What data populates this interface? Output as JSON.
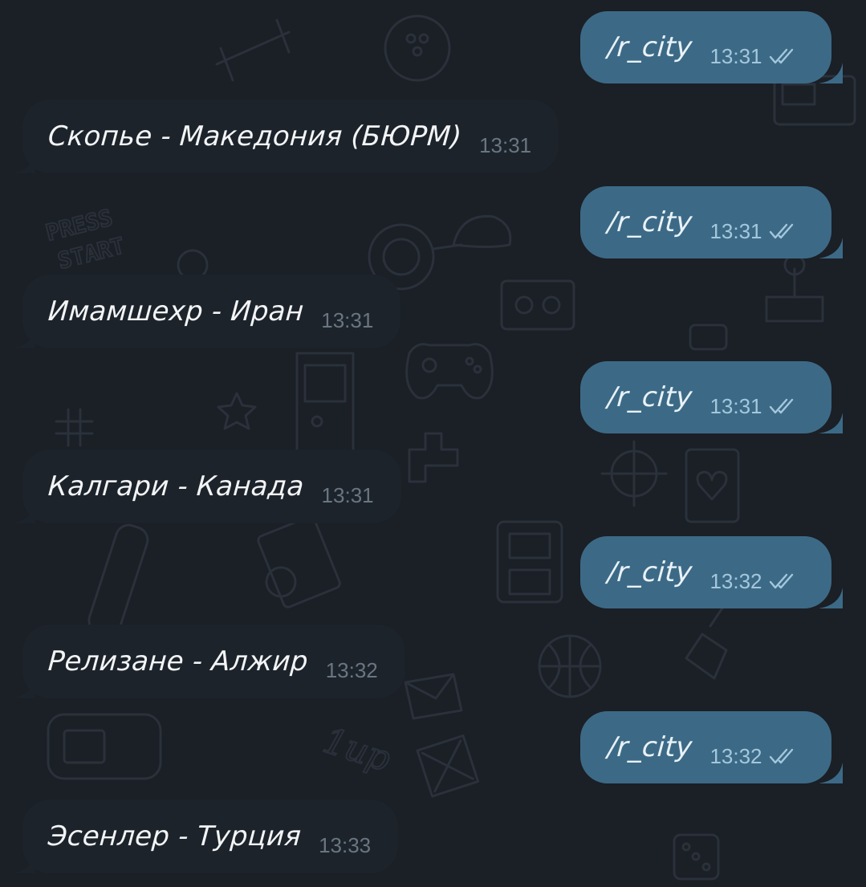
{
  "colors": {
    "background": "#1b1f26",
    "incoming_bubble": "#1c232b",
    "outgoing_bubble": "#3c6a86",
    "incoming_time": "#6a7580",
    "outgoing_time": "#a4c7de",
    "read_checks": "#a4c7de"
  },
  "messages": [
    {
      "direction": "out",
      "text": "/r_city",
      "time": "13:31",
      "status": "read",
      "status_icon": "double-check-icon"
    },
    {
      "direction": "in",
      "text": "Скопье - Македония (БЮРМ)",
      "time": "13:31"
    },
    {
      "direction": "out",
      "text": "/r_city",
      "time": "13:31",
      "status": "read",
      "status_icon": "double-check-icon"
    },
    {
      "direction": "in",
      "text": "Имамшехр - Иран",
      "time": "13:31"
    },
    {
      "direction": "out",
      "text": "/r_city",
      "time": "13:31",
      "status": "read",
      "status_icon": "double-check-icon"
    },
    {
      "direction": "in",
      "text": "Калгари - Канада",
      "time": "13:31"
    },
    {
      "direction": "out",
      "text": "/r_city",
      "time": "13:32",
      "status": "read",
      "status_icon": "double-check-icon"
    },
    {
      "direction": "in",
      "text": "Релизане - Алжир",
      "time": "13:32"
    },
    {
      "direction": "out",
      "text": "/r_city",
      "time": "13:32",
      "status": "read",
      "status_icon": "double-check-icon"
    },
    {
      "direction": "in",
      "text": "Эсенлер - Турция",
      "time": "13:33"
    }
  ]
}
